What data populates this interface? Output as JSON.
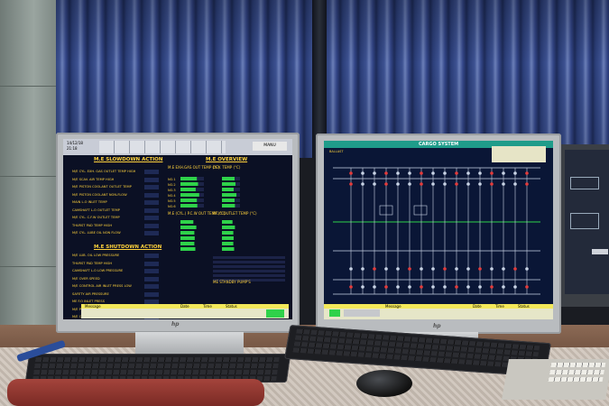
{
  "left_monitor": {
    "header_date": "14/12/18",
    "header_time": "21:18",
    "header_tag": "MANU",
    "slowdown_title": "M.E SLOWDOWN ACTION",
    "shutdown_title": "M.E SHUTDOWN ACTION",
    "overview_title": "M.E OVERVIEW",
    "overview_sub1": "M.E EXH.GAS OUT TEMP (°C)",
    "overview_sub2": "DEV. TEMP (°C)",
    "overview_sub3": "M.E (CYL.) P.C.W OUT TEMP (°C)",
    "overview_sub4": "P.C.O OUTLET TEMP (°C)",
    "standby_title": "ME STANDBY PUMP'S",
    "slowdown_items": [
      "M/E CYL. EXH. GAS OUTLET TEMP HIGH",
      "M/E SCAV. AIR TEMP HIGH",
      "M/E PISTON COOLANT OUTLET TEMP",
      "M/E PISTON COOLANT NON-FLOW",
      "MAIN L.O INLET TEMP",
      "CAMSHAFT L.O OUTLET TEMP",
      "M/E CYL. C.F.W OUTLET TEMP",
      "THURST PAD TEMP HIGH",
      "M/E CYL. LUBE OIL NON FLOW"
    ],
    "shutdown_items": [
      "M/E LUB. OIL LOW PRESSURE",
      "THURST PAD TEMP HIGH",
      "CAMSHAFT L.O LOW PRESSURE",
      "M/E OVER SPEED",
      "M/E CONTROL AIR INLET PRESS LOW",
      "SAFETY AIR PRESSURE",
      "ME F.O INLET PRESS",
      "M/E PISTON COOL. OIL INLET PRESS",
      "M/E CAMSHAFT L.O INLET PRESS"
    ],
    "cylinders": [
      "NO.1",
      "NO.2",
      "NO.3",
      "NO.4",
      "NO.5",
      "NO.6"
    ],
    "exh_bar_levels": [
      0.7,
      0.75,
      0.65,
      0.8,
      0.7,
      0.72
    ],
    "msg_headers": [
      "Message",
      "Date",
      "Time",
      "Status"
    ]
  },
  "right_monitor": {
    "title": "CARGO SYSTEM",
    "top_left_label": "BALLAST",
    "msg_headers": [
      "Message",
      "Date",
      "Time",
      "Status"
    ]
  },
  "brand_label": "hp"
}
